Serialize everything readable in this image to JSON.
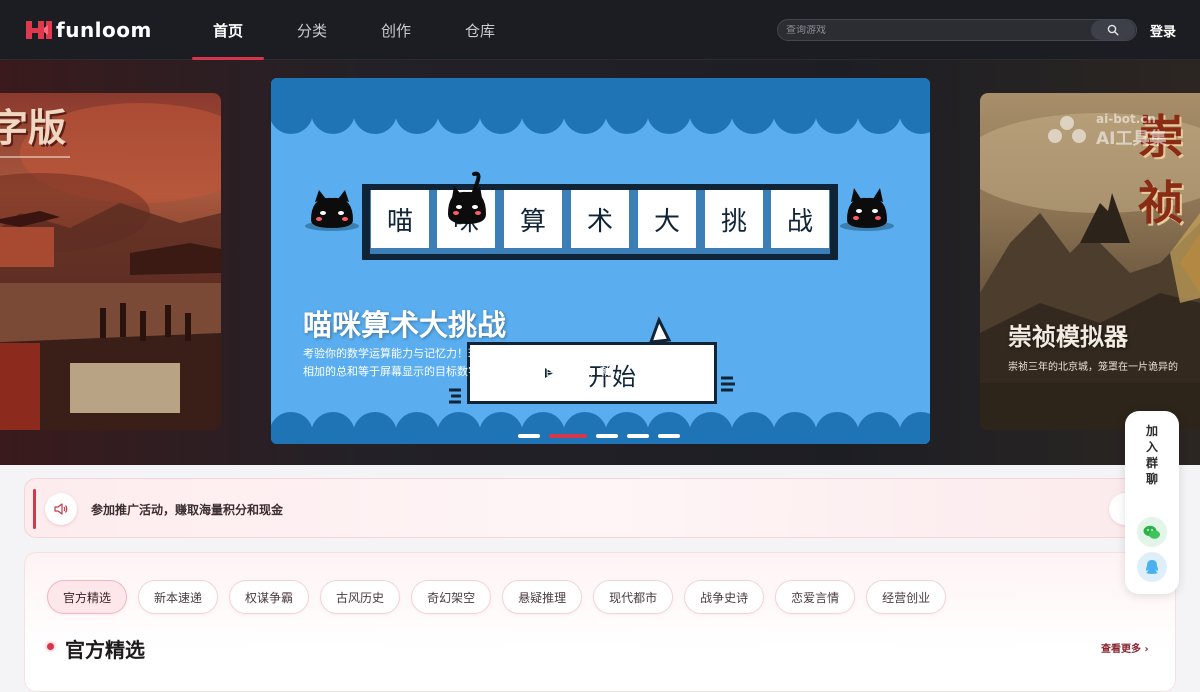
{
  "header": {
    "logo_text": "funloom",
    "nav": [
      "首页",
      "分类",
      "创作",
      "仓库"
    ],
    "active_nav": 0,
    "search_placeholder": "查询游戏",
    "login_label": "登录",
    "accent_color": "#d5364b"
  },
  "watermark": {
    "line1": "ai-bot.cn",
    "line2": "AI工具集"
  },
  "carousel": {
    "left_card_title": "字版",
    "right_card_title_big": "崇祯",
    "right_card_title": "崇祯模拟器",
    "right_card_desc": "崇祯三年的北京城，笼罩在一片诡异的",
    "main": {
      "tiles": [
        "喵",
        "咪",
        "算",
        "术",
        "大",
        "挑",
        "战"
      ],
      "title": "喵咪算术大挑战",
      "description": "考验你的数学运算能力与记忆力！玩法简单易懂：你需要挑选数字方块，使它们相加的总和等于屏幕显示的目标数字。若总和超出目标数值，就...",
      "start_label": "开始",
      "background_color": "#5aaef0"
    },
    "dots_count": 5,
    "active_dot": 1
  },
  "promo": {
    "text": "参加推广活动，赚取海量积分和现金",
    "icon": "speaker-icon"
  },
  "categories": {
    "tags": [
      "官方精选",
      "新本速递",
      "权谋争霸",
      "古风历史",
      "奇幻架空",
      "悬疑推理",
      "现代都市",
      "战争史诗",
      "恋爱言情",
      "经营创业"
    ],
    "active_tag": 0
  },
  "section": {
    "title": "官方精选",
    "view_more": "查看更多 ›"
  },
  "float_panel": {
    "label": [
      "加",
      "入",
      "群",
      "聊"
    ],
    "buttons": [
      "wechat-icon",
      "qq-icon"
    ]
  }
}
